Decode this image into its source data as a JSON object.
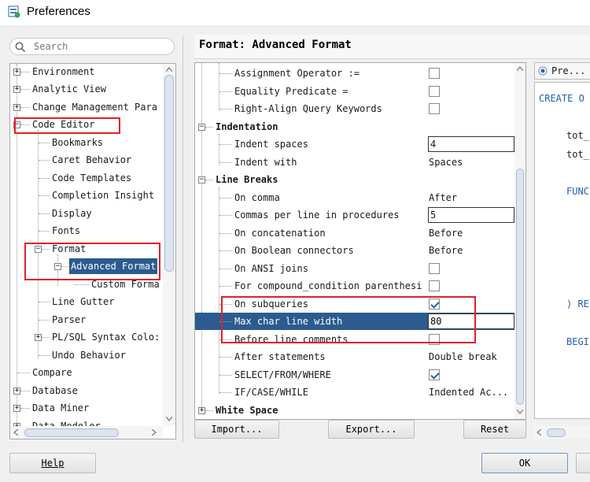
{
  "window": {
    "title": "Preferences"
  },
  "search": {
    "placeholder": "Search"
  },
  "tree": {
    "items": [
      {
        "label": "Environment"
      },
      {
        "label": "Analytic View"
      },
      {
        "label": "Change Management Para"
      },
      {
        "label": "Code Editor"
      },
      {
        "label": "Bookmarks"
      },
      {
        "label": "Caret Behavior"
      },
      {
        "label": "Code Templates"
      },
      {
        "label": "Completion Insight"
      },
      {
        "label": "Display"
      },
      {
        "label": "Fonts"
      },
      {
        "label": "Format"
      },
      {
        "label": "Advanced Format"
      },
      {
        "label": "Custom Forma"
      },
      {
        "label": "Line Gutter"
      },
      {
        "label": "Parser"
      },
      {
        "label": "PL/SQL Syntax Colo:"
      },
      {
        "label": "Undo Behavior"
      },
      {
        "label": "Compare"
      },
      {
        "label": "Database"
      },
      {
        "label": "Data Miner"
      },
      {
        "label": "Data Modeler"
      }
    ]
  },
  "main": {
    "title": "Format: Advanced Format",
    "properties": [
      {
        "label": "Assignment Operator :=",
        "type": "checkbox",
        "checked": false
      },
      {
        "label": "Equality Predicate =",
        "type": "checkbox",
        "checked": false
      },
      {
        "label": "Right-Align Query Keywords",
        "type": "checkbox",
        "checked": false
      },
      {
        "label": "Indentation",
        "type": "group"
      },
      {
        "label": "Indent spaces",
        "type": "text",
        "value": "4"
      },
      {
        "label": "Indent with",
        "type": "value",
        "value": "Spaces"
      },
      {
        "label": "Line Breaks",
        "type": "group"
      },
      {
        "label": "On comma",
        "type": "value",
        "value": "After"
      },
      {
        "label": "Commas per line in procedures",
        "type": "text",
        "value": "5"
      },
      {
        "label": "On concatenation",
        "type": "value",
        "value": "Before"
      },
      {
        "label": "On Boolean connectors",
        "type": "value",
        "value": "Before"
      },
      {
        "label": "On ANSI joins",
        "type": "checkbox",
        "checked": false
      },
      {
        "label": "For compound_condition parenthesi",
        "type": "checkbox",
        "checked": false
      },
      {
        "label": "On subqueries",
        "type": "checkbox",
        "checked": true
      },
      {
        "label": "Max char line width",
        "type": "text",
        "value": "80"
      },
      {
        "label": "Before line comments",
        "type": "checkbox",
        "checked": false
      },
      {
        "label": "After statements",
        "type": "value",
        "value": "Double break"
      },
      {
        "label": "SELECT/FROM/WHERE",
        "type": "checkbox",
        "checked": true
      },
      {
        "label": "IF/CASE/WHILE",
        "type": "value",
        "value": "Indented Ac..."
      },
      {
        "label": "White Space",
        "type": "group"
      }
    ],
    "buttons": {
      "import": "Import...",
      "export": "Export...",
      "reset": "Reset"
    }
  },
  "preview": {
    "tab_label": "Pre...",
    "lines": [
      "CREATE O",
      "tot_",
      "tot_",
      "FUNC",
      ") RE",
      "BEGI"
    ]
  },
  "footer": {
    "help": "Help",
    "ok": "OK"
  },
  "colors": {
    "selection": "#2b5b8f",
    "highlight_box": "#e0202a",
    "code": "#1f5fad"
  }
}
